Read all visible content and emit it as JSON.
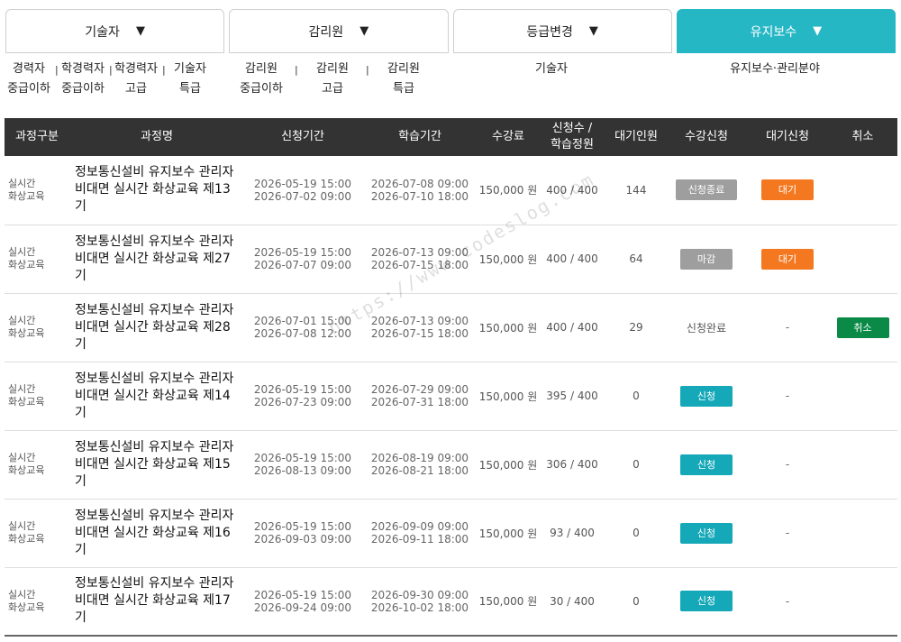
{
  "tabs": [
    {
      "label": "기술자",
      "active": false
    },
    {
      "label": "감리원",
      "active": false
    },
    {
      "label": "등급변경",
      "active": false
    },
    {
      "label": "유지보수",
      "active": true
    }
  ],
  "tab_arrow": "▼",
  "subtabs": {
    "s1_l1": "경력자",
    "s1_l2": "중급이하",
    "s2_l1": "학경력자",
    "s2_l2": "중급이하",
    "s3_l1": "학경력자",
    "s3_l2": "고급",
    "s4_l1": "기술자",
    "s4_l2": "특급",
    "s5_l1": "감리원",
    "s5_l2": "중급이하",
    "s6_l1": "감리원",
    "s6_l2": "고급",
    "s7_l1": "감리원",
    "s7_l2": "특급",
    "s8": "기술자",
    "s9": "유지보수·관리분야",
    "sep": "|"
  },
  "columns": {
    "kind": "과정구분",
    "name": "과정명",
    "apply_period": "신청기간",
    "study_period": "학습기간",
    "fee": "수강료",
    "count_l1": "신청수 /",
    "count_l2": "학습정원",
    "waiting": "대기인원",
    "enroll": "수강신청",
    "wait_apply": "대기신청",
    "cancel": "취소"
  },
  "kind_l1": "실시간",
  "kind_l2": "화상교육",
  "dash": "-",
  "rows": [
    {
      "name": "정보통신설비 유지보수 관리자 비대면 실시간 화상교육 제13기",
      "apply_start": "2026-05-19 15:00",
      "apply_end": "2026-07-02 09:00",
      "study_start": "2026-07-08 09:00",
      "study_end": "2026-07-10 18:00",
      "fee": "150,000 원",
      "count": "400 / 400",
      "waiting": "144",
      "enroll": "신청종료",
      "wait_apply": "대기",
      "cancel": ""
    },
    {
      "name": "정보통신설비 유지보수 관리자 비대면 실시간 화상교육 제27기",
      "apply_start": "2026-05-19 15:00",
      "apply_end": "2026-07-07 09:00",
      "study_start": "2026-07-13 09:00",
      "study_end": "2026-07-15 18:00",
      "fee": "150,000 원",
      "count": "400 / 400",
      "waiting": "64",
      "enroll": "마감",
      "wait_apply": "대기",
      "cancel": ""
    },
    {
      "name": "정보통신설비 유지보수 관리자 비대면 실시간 화상교육 제28기",
      "apply_start": "2026-07-01 15:00",
      "apply_end": "2026-07-08 12:00",
      "study_start": "2026-07-13 09:00",
      "study_end": "2026-07-15 18:00",
      "fee": "150,000 원",
      "count": "400 / 400",
      "waiting": "29",
      "enroll": "신청완료",
      "wait_apply": "-",
      "cancel": "취소"
    },
    {
      "name": "정보통신설비 유지보수 관리자 비대면 실시간 화상교육 제14기",
      "apply_start": "2026-05-19 15:00",
      "apply_end": "2026-07-23 09:00",
      "study_start": "2026-07-29 09:00",
      "study_end": "2026-07-31 18:00",
      "fee": "150,000 원",
      "count": "395 / 400",
      "waiting": "0",
      "enroll": "신청",
      "wait_apply": "-",
      "cancel": ""
    },
    {
      "name": "정보통신설비 유지보수 관리자 비대면 실시간 화상교육 제15기",
      "apply_start": "2026-05-19 15:00",
      "apply_end": "2026-08-13 09:00",
      "study_start": "2026-08-19 09:00",
      "study_end": "2026-08-21 18:00",
      "fee": "150,000 원",
      "count": "306 / 400",
      "waiting": "0",
      "enroll": "신청",
      "wait_apply": "-",
      "cancel": ""
    },
    {
      "name": "정보통신설비 유지보수 관리자 비대면 실시간 화상교육 제16기",
      "apply_start": "2026-05-19 15:00",
      "apply_end": "2026-09-03 09:00",
      "study_start": "2026-09-09 09:00",
      "study_end": "2026-09-11 18:00",
      "fee": "150,000 원",
      "count": "93 / 400",
      "waiting": "0",
      "enroll": "신청",
      "wait_apply": "-",
      "cancel": ""
    },
    {
      "name": "정보통신설비 유지보수 관리자 비대면 실시간 화상교육 제17기",
      "apply_start": "2026-05-19 15:00",
      "apply_end": "2026-09-24 09:00",
      "study_start": "2026-09-30 09:00",
      "study_end": "2026-10-02 18:00",
      "fee": "150,000 원",
      "count": "30 / 400",
      "waiting": "0",
      "enroll": "신청",
      "wait_apply": "-",
      "cancel": ""
    }
  ],
  "watermark": "https://www.codeslog.com",
  "colors": {
    "active_tab": "#26b7c4",
    "header_bg": "#333333",
    "wait_btn": "#f47820",
    "apply_btn": "#14a8b8",
    "cancel_btn": "#0b8a47",
    "closed_btn": "#9e9e9e"
  }
}
